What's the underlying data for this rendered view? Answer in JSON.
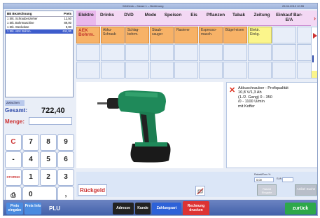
{
  "window_title": "WinDesk – Kasse 1 – Bedienung",
  "window_time": "26.04.2012 10:55",
  "receipt": {
    "header_left": "BE Bezeichnung",
    "header_right": "Preis",
    "rows": [
      {
        "text": "1 Stk. Schraubenzieher",
        "price": "12,50",
        "selected": false
      },
      {
        "text": "1 Stk. Bohrmaschine",
        "price": "89,00",
        "selected": false
      },
      {
        "text": "1 Stk. Steckdose",
        "price": "9,90",
        "selected": false
      },
      {
        "text": "1 Stk. AEK Bohrm.",
        "price": "611,00",
        "selected": true
      }
    ]
  },
  "categories": [
    "Elektro",
    "Drinks",
    "DVD",
    "Mode",
    "Speisen",
    "Eis",
    "Pflanzen",
    "Tabak",
    "Zeitung",
    "Einkauf Bar-E/A"
  ],
  "grid_row1": [
    {
      "label": "AEK Bohrm.",
      "style": "o"
    },
    {
      "label": "Akku-Schraub",
      "style": "o"
    },
    {
      "label": "Schlag-bohrm.",
      "style": "o"
    },
    {
      "label": "Staub-sauger",
      "style": "o"
    },
    {
      "label": "Rasierer",
      "style": "o"
    },
    {
      "label": "Espresso-masch.",
      "style": "o"
    },
    {
      "label": "Bügel-eisen",
      "style": "o"
    },
    {
      "label": "Elektr. Einkg.",
      "style": "y"
    }
  ],
  "product": {
    "description": "Akkuschrauber - Profiqualität\n10,8 V/1,3 Ah\n(1./2. Gang) 0 - 350\n/0 - 1100 U/min\nmit Koffer"
  },
  "totals": {
    "small_label": "Zwischen",
    "label": "Gesamt:",
    "value": "722,40",
    "menge_label": "Menge:"
  },
  "keypad": {
    "keys": [
      "C",
      "7",
      "8",
      "9",
      "-",
      "4",
      "5",
      "6",
      "",
      "1",
      "2",
      "3",
      "",
      "0",
      ","
    ],
    "storno_label": "STORNO",
    "rueckgeld_label": "Rückgeld"
  },
  "midbar": {
    "small1": "Rabatt/Euro %",
    "value1": "0,00",
    "small2": "EAN",
    "btn1": "Rabatt Eingabe",
    "btn2": "Artikel Suche"
  },
  "bottom": {
    "preis_eingabe": "Preis eingabe",
    "preis_info": "Preis Info",
    "plu": "PLU",
    "adresse": "Adresse",
    "kunde": "Kunde",
    "zahlungsart": "Zahlungsart",
    "rechnung": "Rechnung drucken",
    "zurueck": "zurück"
  },
  "colors": {
    "accent": "#e9b8ec",
    "orange": "#f7b267",
    "yellow": "#fbf58b",
    "green": "#2da84a",
    "red": "#d33",
    "blue": "#3d5ccc"
  }
}
